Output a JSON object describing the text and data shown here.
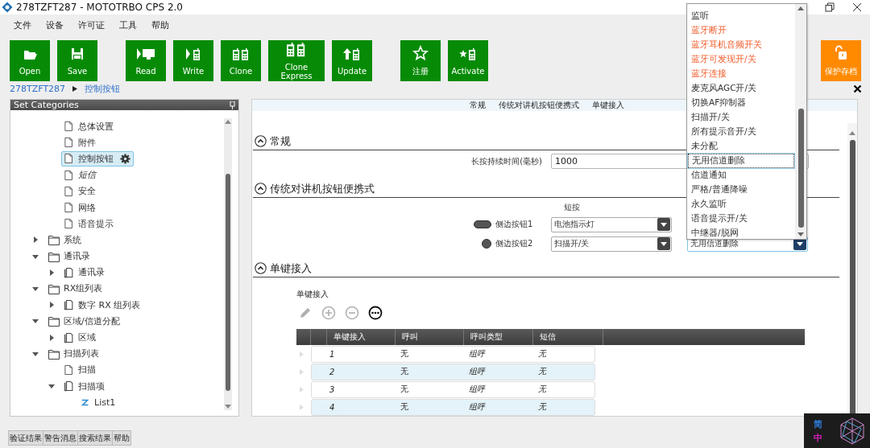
{
  "window": {
    "title": "278TZFT287 - MOTOTRBO CPS 2.0"
  },
  "menu": [
    "文件",
    "设备",
    "许可证",
    "工具",
    "帮助"
  ],
  "toolbar": {
    "groups": [
      [
        {
          "kind": "open",
          "label": "Open"
        },
        {
          "kind": "save",
          "label": "Save"
        }
      ],
      [
        {
          "kind": "read",
          "label": "Read"
        },
        {
          "kind": "write",
          "label": "Write"
        },
        {
          "kind": "clone",
          "label": "Clone"
        },
        {
          "kind": "clone_express",
          "label": "Clone Express"
        },
        {
          "kind": "update",
          "label": "Update"
        }
      ],
      [
        {
          "kind": "register",
          "label": "注册"
        },
        {
          "kind": "activate",
          "label": "Activate"
        }
      ]
    ],
    "protect_button": {
      "label": "保护存档"
    }
  },
  "breadcrumb": [
    "278TZFT287",
    "控制按钮"
  ],
  "sidebar": {
    "title": "Set Categories",
    "tree": [
      {
        "children": [
          {
            "kind": "page",
            "label": "总体设置",
            "selected": false
          },
          {
            "kind": "page",
            "label": "附件",
            "selected": false
          },
          {
            "kind": "page",
            "label": "控制按钮",
            "selected": true
          },
          {
            "kind": "page",
            "label": "短信",
            "selected": false,
            "italic": true
          },
          {
            "kind": "page",
            "label": "安全",
            "selected": false
          },
          {
            "kind": "page",
            "label": "网络",
            "selected": false
          },
          {
            "kind": "page",
            "label": "语音提示",
            "selected": false
          }
        ]
      },
      {
        "kind": "folder",
        "label": "系统",
        "selected": false,
        "expanded": false
      },
      {
        "kind": "folder",
        "label": "通讯录",
        "selected": false,
        "expanded": true,
        "children": [
          {
            "kind": "book",
            "label": "通讯录",
            "selected": false,
            "expanded": false
          }
        ]
      },
      {
        "kind": "folder",
        "label": "RX组列表",
        "selected": false,
        "expanded": true,
        "children": [
          {
            "kind": "book",
            "label": "数字 RX 组列表",
            "selected": false,
            "expanded": false
          }
        ]
      },
      {
        "kind": "folder",
        "label": "区域/信道分配",
        "selected": false,
        "expanded": true,
        "children": [
          {
            "kind": "book",
            "label": "区域",
            "selected": false,
            "expanded": false
          }
        ]
      },
      {
        "kind": "folder",
        "label": "扫描列表",
        "selected": false,
        "expanded": true,
        "children": [
          {
            "kind": "page",
            "label": "扫描",
            "selected": false
          },
          {
            "kind": "book",
            "label": "扫描项",
            "selected": false,
            "expanded": true,
            "children": [
              {
                "kind": "list",
                "label": "List1",
                "selected": false
              }
            ]
          }
        ]
      }
    ]
  },
  "content": {
    "tabs": [
      "常规",
      "传统对讲机按钮便携式",
      "单键接入"
    ],
    "general": {
      "title": "常规",
      "field_label": "长按持续时间(毫秒)",
      "field_value": "1000"
    },
    "buttons": {
      "title": "传统对讲机按钮便携式",
      "short_press_header": "短按",
      "rows": [
        {
          "kind": "oval",
          "label": "侧边按钮1",
          "short_press": "电池指示灯"
        },
        {
          "kind": "round",
          "label": "侧边按钮2",
          "short_press": "扫描开/关",
          "long_press": "无用信道删除"
        }
      ]
    },
    "one_touch": {
      "title": "单键接入",
      "subtitle": "单键接入",
      "tools": [
        {
          "kind": "edit",
          "disabled": true
        },
        {
          "kind": "add",
          "disabled": true
        },
        {
          "kind": "remove",
          "disabled": true
        },
        {
          "kind": "more",
          "disabled": false
        }
      ],
      "columns": [
        "单键接入",
        "呼叫",
        "呼叫类型",
        "短信"
      ],
      "rows": [
        [
          "1",
          "无",
          "组呼",
          "无"
        ],
        [
          "2",
          "无",
          "组呼",
          "无"
        ],
        [
          "3",
          "无",
          "组呼",
          "无"
        ],
        [
          "4",
          "无",
          "组呼",
          "无"
        ]
      ]
    }
  },
  "dropdown_list": [
    {
      "label": "监听",
      "highlighted": false,
      "selected": false
    },
    {
      "label": "蓝牙断开",
      "highlighted": true,
      "selected": false
    },
    {
      "label": "蓝牙耳机音频开关",
      "highlighted": true,
      "selected": false
    },
    {
      "label": "蓝牙可发现开/关",
      "highlighted": true,
      "selected": false
    },
    {
      "label": "蓝牙连接",
      "highlighted": true,
      "selected": false
    },
    {
      "label": "麦克风AGC开/关",
      "highlighted": false,
      "selected": false
    },
    {
      "label": "切换AF抑制器",
      "highlighted": false,
      "selected": false
    },
    {
      "label": "扫描开/关",
      "highlighted": false,
      "selected": false
    },
    {
      "label": "所有提示音开/关",
      "highlighted": false,
      "selected": false
    },
    {
      "label": "未分配",
      "highlighted": false,
      "selected": false
    },
    {
      "label": "无用信道删除",
      "highlighted": false,
      "selected": true
    },
    {
      "label": "信道通知",
      "highlighted": false,
      "selected": false
    },
    {
      "label": "严格/普通降噪",
      "highlighted": false,
      "selected": false
    },
    {
      "label": "永久监听",
      "highlighted": false,
      "selected": false
    },
    {
      "label": "语音提示开/关",
      "highlighted": false,
      "selected": false
    },
    {
      "label": "中继器/脱网",
      "highlighted": false,
      "selected": false
    }
  ],
  "bottom_tabs": [
    "验证结果",
    "警告消息",
    "搜索结果",
    "帮助"
  ],
  "ime_indicator": [
    "简",
    "中"
  ]
}
